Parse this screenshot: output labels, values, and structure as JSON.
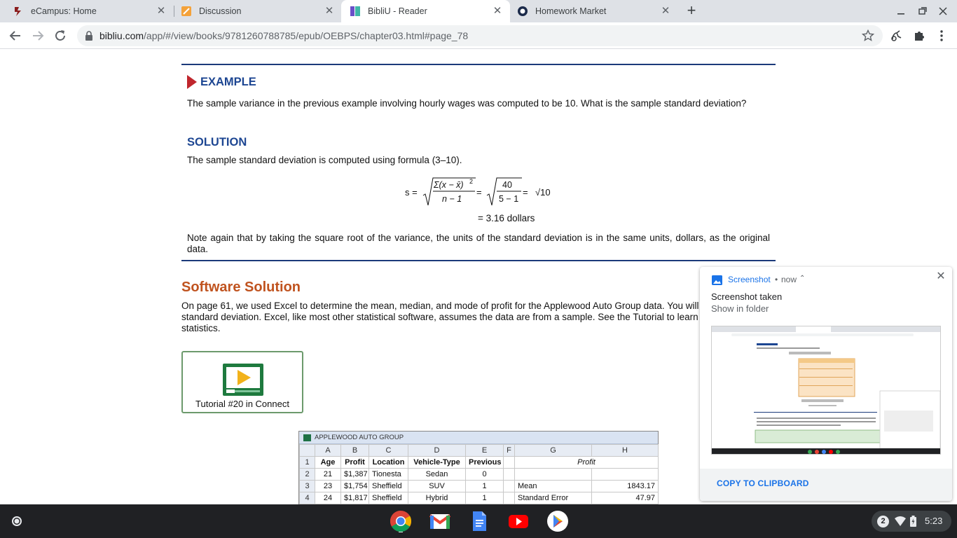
{
  "browser": {
    "tabs": [
      {
        "title": "eCampus: Home",
        "close": "✕"
      },
      {
        "title": "Discussion",
        "close": "✕"
      },
      {
        "title": "BibliU - Reader",
        "close": "✕"
      },
      {
        "title": "Homework Market",
        "close": "✕"
      }
    ],
    "new_tab": "+",
    "url_host": "bibliu.com",
    "url_path": "/app/#/view/books/9781260788785/epub/OEBPS/chapter03.html#page_78"
  },
  "book": {
    "example_heading": "EXAMPLE",
    "example_text": "The sample variance in the previous example involving hourly wages was computed to be 10. What is the sample standard deviation?",
    "solution_heading": "SOLUTION",
    "solution_text": "The sample standard deviation is computed using formula (3–10).",
    "formula": {
      "lhs": "s =",
      "numerator": "Σ(x − x̄)",
      "exponent": "2",
      "denominator": "n − 1",
      "eq1": "=",
      "num2": "40",
      "den2": "5 − 1",
      "eq2": "=",
      "sqrt10": "√10"
    },
    "result": "= 3.16 dollars",
    "note_text": "Note again that by taking the square root of the variance, the units of the standard deviation is in the same units, dollars, as the original data.",
    "software_heading": "Software Solution",
    "software_text": "On page 61, we used Excel to determine the mean, median, and mode of profit for the Applewood Auto Group data. You will note that it lists the sample variance and sample standard deviation. Excel, like most other statistical software, assumes the data are from a sample. See the Tutorial to learn how to use Excel to compute the list of descriptive statistics.",
    "tutorial_label": "Tutorial #20 in Connect"
  },
  "spreadsheet": {
    "title": "APPLEWOOD AUTO GROUP",
    "columns": [
      "A",
      "B",
      "C",
      "D",
      "E",
      "F",
      "G",
      "H"
    ],
    "rows": [
      {
        "n": "1",
        "cells": [
          "Age",
          "Profit",
          "Location",
          "Vehicle-Type",
          "Previous",
          "",
          "Profit",
          ""
        ]
      },
      {
        "n": "2",
        "cells": [
          "21",
          "$1,387",
          "Tionesta",
          "Sedan",
          "0",
          "",
          "",
          ""
        ]
      },
      {
        "n": "3",
        "cells": [
          "23",
          "$1,754",
          "Sheffield",
          "SUV",
          "1",
          "",
          "Mean",
          "1843.17"
        ]
      },
      {
        "n": "4",
        "cells": [
          "24",
          "$1,817",
          "Sheffield",
          "Hybrid",
          "1",
          "",
          "Standard Error",
          "47.97"
        ]
      }
    ]
  },
  "notification": {
    "app": "Screenshot",
    "dot": "•",
    "time": "now",
    "title": "Screenshot taken",
    "subtitle": "Show in folder",
    "action": "COPY TO CLIPBOARD",
    "close": "✕",
    "chevron": "⌃"
  },
  "shelf": {
    "notification_count": "2",
    "time": "5:23"
  },
  "colors": {
    "accent_blue": "#1d4692",
    "section_orange": "#c0531f",
    "link_blue": "#1a73e8"
  }
}
